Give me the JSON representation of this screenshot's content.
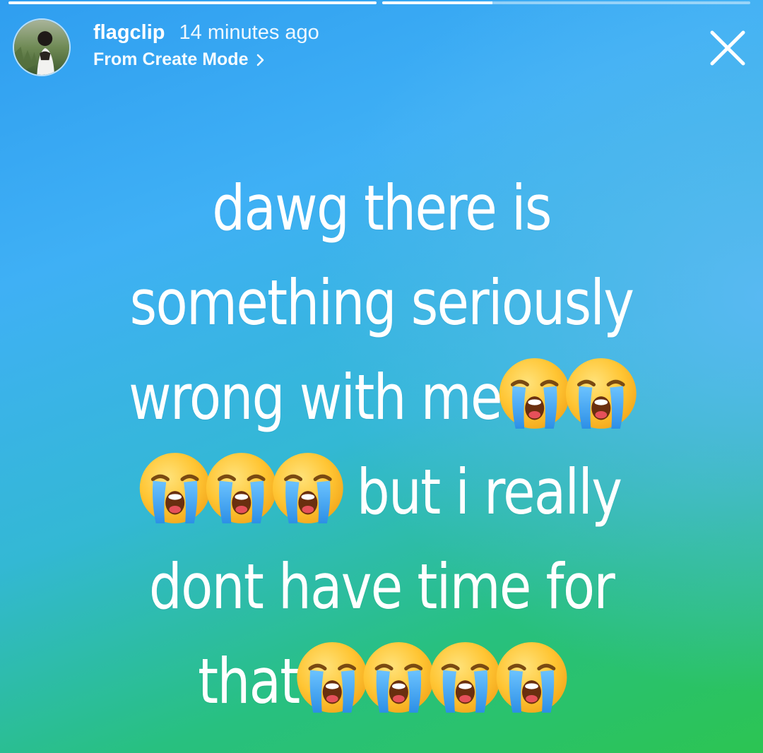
{
  "progress": {
    "segments": [
      {
        "fill_fraction": 1.0
      },
      {
        "fill_fraction": 0.3
      }
    ]
  },
  "header": {
    "username": "flagclip",
    "timestamp": "14 minutes ago",
    "source_label": "From Create Mode",
    "avatar_icon": "profile-photo",
    "close_icon": "close-x-icon"
  },
  "story_text": {
    "line1": "dawg there is",
    "line2": "something seriously",
    "line3": "wrong with me",
    "line4": "but i really",
    "line5": "dont have time for",
    "line6": "that",
    "emoji_name": "loudly-crying-face"
  },
  "colors": {
    "bg_top": "#2f9ef0",
    "bg_right": "#58b9f2",
    "bg_bottom_left": "#2cc452",
    "text": "#ffffff"
  }
}
